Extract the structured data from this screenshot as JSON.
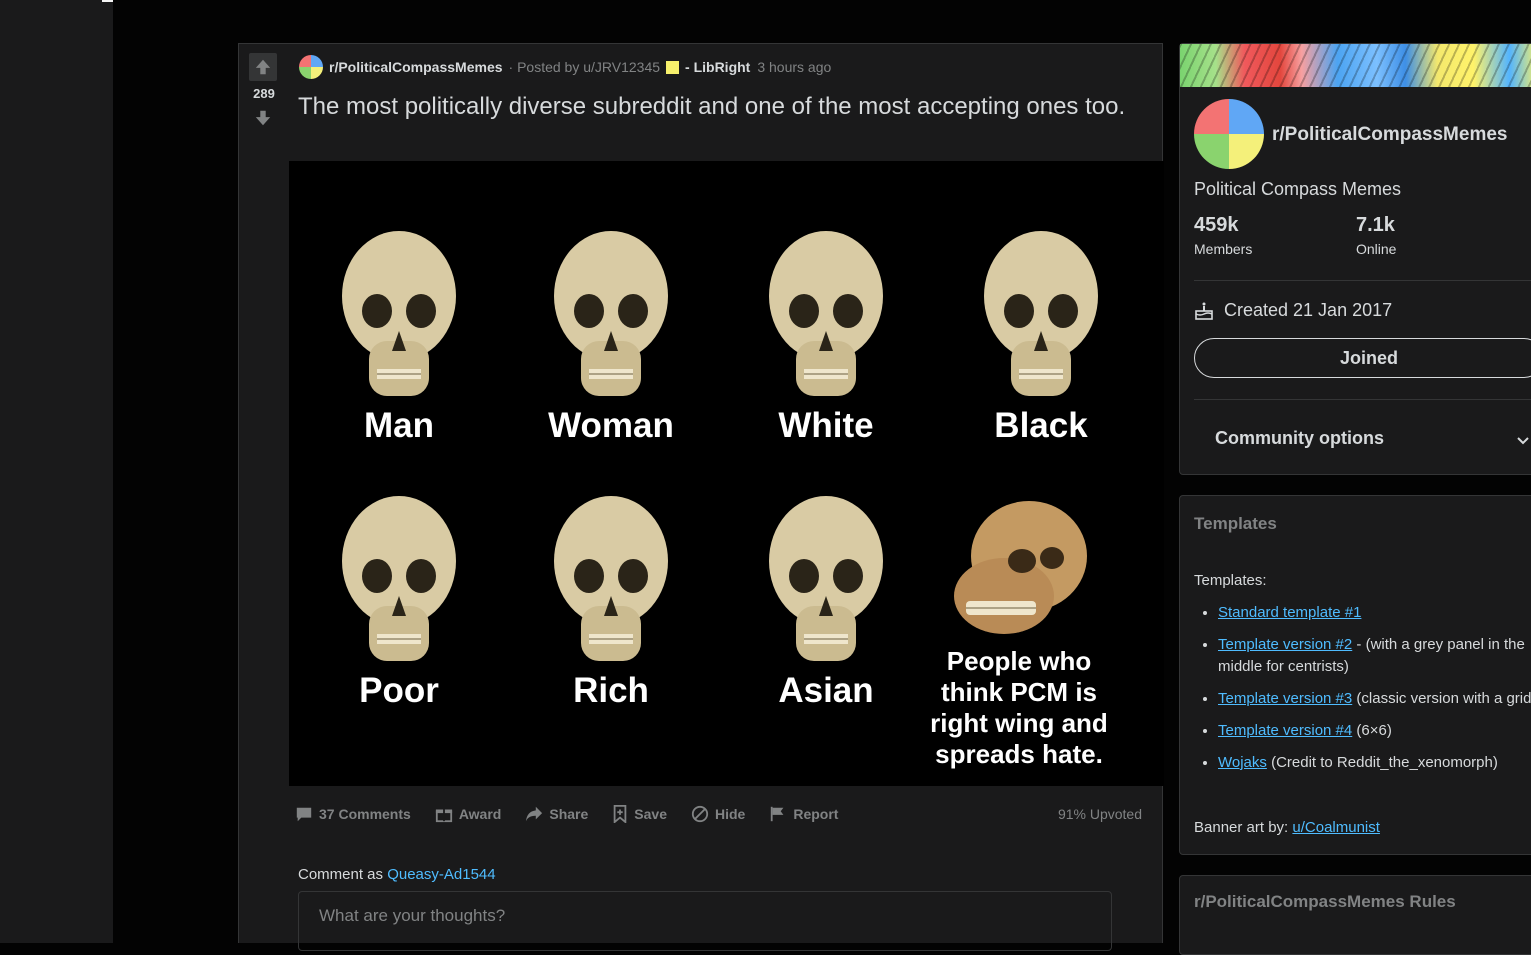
{
  "post": {
    "score": "289",
    "subreddit": "r/PoliticalCompassMemes",
    "posted_by": "· Posted by u/JRV12345",
    "flair": "- LibRight",
    "time": "3 hours ago",
    "title": "The most politically diverse subreddit and one of the most accepting ones too.",
    "image_captions": [
      "Man",
      "Woman",
      "White",
      "Black",
      "Poor",
      "Rich",
      "Asian",
      "People who think PCM is right wing and spreads hate."
    ],
    "actions": {
      "comments": "37 Comments",
      "award": "Award",
      "share": "Share",
      "save": "Save",
      "hide": "Hide",
      "report": "Report"
    },
    "upvoted": "91% Upvoted",
    "comment_as_label": "Comment as",
    "comment_user": "Queasy-Ad1544",
    "comment_placeholder": "What are your thoughts?"
  },
  "sidebar": {
    "sub_name": "r/PoliticalCompassMemes",
    "description": "Political Compass Memes",
    "members_count": "459k",
    "members_label": "Members",
    "online_count": "7.1k",
    "online_label": "Online",
    "created": "Created 21 Jan 2017",
    "joined_button": "Joined",
    "community_options": "Community options",
    "templates_heading": "Templates",
    "templates_sub": "Templates:",
    "templates": [
      {
        "link": "Standard template #1",
        "note": ""
      },
      {
        "link": "Template version #2",
        "note": " - (with a grey panel in the middle for centrists)"
      },
      {
        "link": "Template version #3",
        "note": " (classic version with a grid)"
      },
      {
        "link": "Template version #4",
        "note": " (6×6)"
      },
      {
        "link": "Wojaks",
        "note": " (Credit to Reddit_the_xenomorph)"
      }
    ],
    "banner_credit_label": "Banner art by:",
    "banner_credit_user": "u/Coalmunist",
    "rules_heading": "r/PoliticalCompassMemes Rules"
  },
  "colors": {
    "background": "#030303",
    "card": "#1a1a1b",
    "text": "#d7dadc",
    "muted": "#818384",
    "link": "#4fbcff",
    "flair": "#f7f06c"
  }
}
